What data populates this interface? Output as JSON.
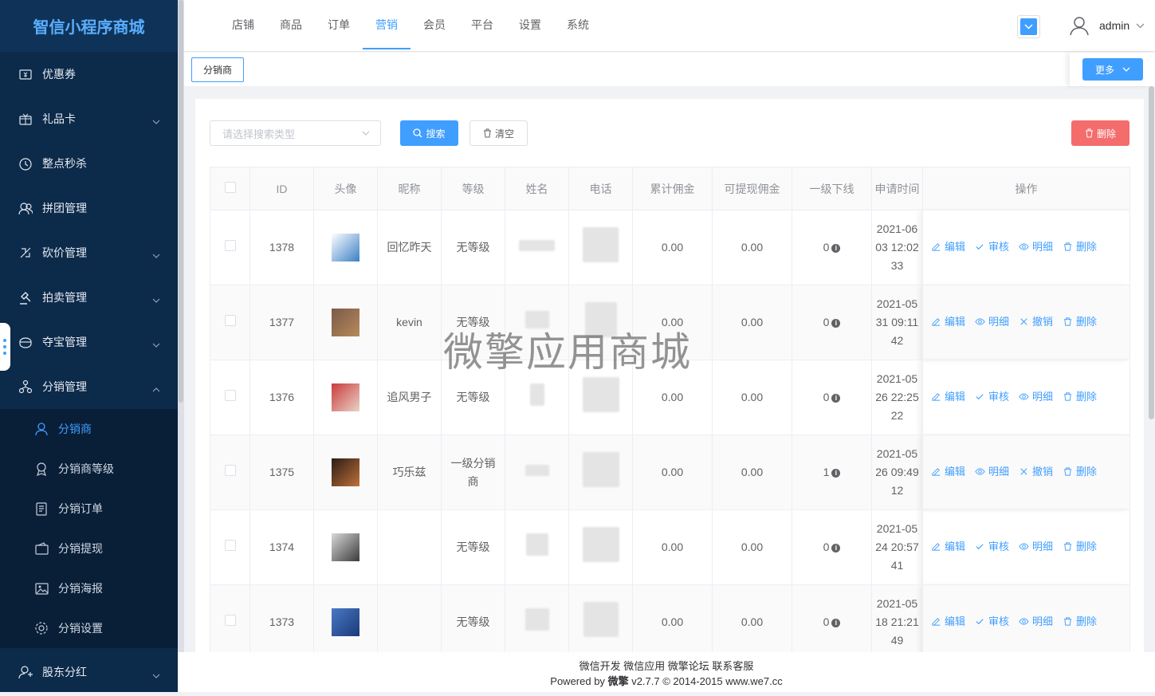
{
  "app": {
    "title": "智信小程序商城"
  },
  "sidebar": {
    "items": [
      {
        "label": "优惠券",
        "icon": "coupon-icon",
        "has_arrow": false
      },
      {
        "label": "礼品卡",
        "icon": "gift-card-icon",
        "has_arrow": true
      },
      {
        "label": "整点秒杀",
        "icon": "flash-sale-icon",
        "has_arrow": false
      },
      {
        "label": "拼团管理",
        "icon": "group-icon",
        "has_arrow": false
      },
      {
        "label": "砍价管理",
        "icon": "bargain-icon",
        "has_arrow": true
      },
      {
        "label": "拍卖管理",
        "icon": "auction-icon",
        "has_arrow": true
      },
      {
        "label": "夺宝管理",
        "icon": "treasure-icon",
        "has_arrow": true
      },
      {
        "label": "分销管理",
        "icon": "distribution-icon",
        "has_arrow": true
      }
    ],
    "sub_items": [
      {
        "label": "分销商",
        "icon": "user-icon",
        "active": true
      },
      {
        "label": "分销商等级",
        "icon": "level-icon",
        "active": false
      },
      {
        "label": "分销订单",
        "icon": "order-icon",
        "active": false
      },
      {
        "label": "分销提现",
        "icon": "wallet-icon",
        "active": false
      },
      {
        "label": "分销海报",
        "icon": "image-icon",
        "active": false
      },
      {
        "label": "分销设置",
        "icon": "gear-icon",
        "active": false
      }
    ],
    "last_item": {
      "label": "股东分红",
      "icon": "shareholder-icon"
    }
  },
  "topnav": {
    "items": [
      "店铺",
      "商品",
      "订单",
      "营销",
      "会员",
      "平台",
      "设置",
      "系统"
    ],
    "active": "营销",
    "user": "admin"
  },
  "tabs": {
    "current": "分销商",
    "more": "更多"
  },
  "toolbar": {
    "filter_placeholder": "请选择搜索类型",
    "search": "搜索",
    "clear": "清空",
    "delete": "删除"
  },
  "table": {
    "columns": [
      "ID",
      "头像",
      "昵称",
      "等级",
      "姓名",
      "电话",
      "累计佣金",
      "可提现佣金",
      "一级下线",
      "申请时间",
      "操作"
    ],
    "rows": [
      {
        "id": "1378",
        "nickname": "回忆昨天",
        "level": "无等级",
        "total": "0.00",
        "withdrawable": "0.00",
        "downline": "0",
        "date": "2021-06",
        "time": "03 12:02",
        "sec": "33",
        "ops": [
          "编辑",
          "审核",
          "明细",
          "删除"
        ]
      },
      {
        "id": "1377",
        "nickname": "kevin",
        "level": "无等级",
        "total": "0.00",
        "withdrawable": "0.00",
        "downline": "0",
        "date": "2021-05",
        "time": "31 09:11",
        "sec": "42",
        "ops": [
          "编辑",
          "明细",
          "撤销",
          "删除"
        ]
      },
      {
        "id": "1376",
        "nickname": "追风男子",
        "level": "无等级",
        "total": "0.00",
        "withdrawable": "0.00",
        "downline": "0",
        "date": "2021-05",
        "time": "26 22:25",
        "sec": "22",
        "ops": [
          "编辑",
          "审核",
          "明细",
          "删除"
        ]
      },
      {
        "id": "1375",
        "nickname": "巧乐兹",
        "level": "一级分销商",
        "total": "0.00",
        "withdrawable": "0.00",
        "downline": "1",
        "date": "2021-05",
        "time": "26 09:49",
        "sec": "12",
        "ops": [
          "编辑",
          "明细",
          "撤销",
          "删除"
        ]
      },
      {
        "id": "1374",
        "nickname": "",
        "level": "无等级",
        "total": "0.00",
        "withdrawable": "0.00",
        "downline": "0",
        "date": "2021-05",
        "time": "24 20:57",
        "sec": "41",
        "ops": [
          "编辑",
          "审核",
          "明细",
          "删除"
        ]
      },
      {
        "id": "1373",
        "nickname": "",
        "level": "无等级",
        "total": "0.00",
        "withdrawable": "0.00",
        "downline": "0",
        "date": "2021-05",
        "time": "18 21:21",
        "sec": "49",
        "ops": [
          "编辑",
          "审核",
          "明细",
          "删除"
        ]
      }
    ]
  },
  "watermark": "微擎应用商城",
  "footer": {
    "links": "微信开发 微信应用 微擎论坛 联系客服",
    "powered_prefix": "Powered by",
    "brand": "微擎",
    "powered_suffix": "v2.7.7 © 2014-2015 www.we7.cc"
  }
}
